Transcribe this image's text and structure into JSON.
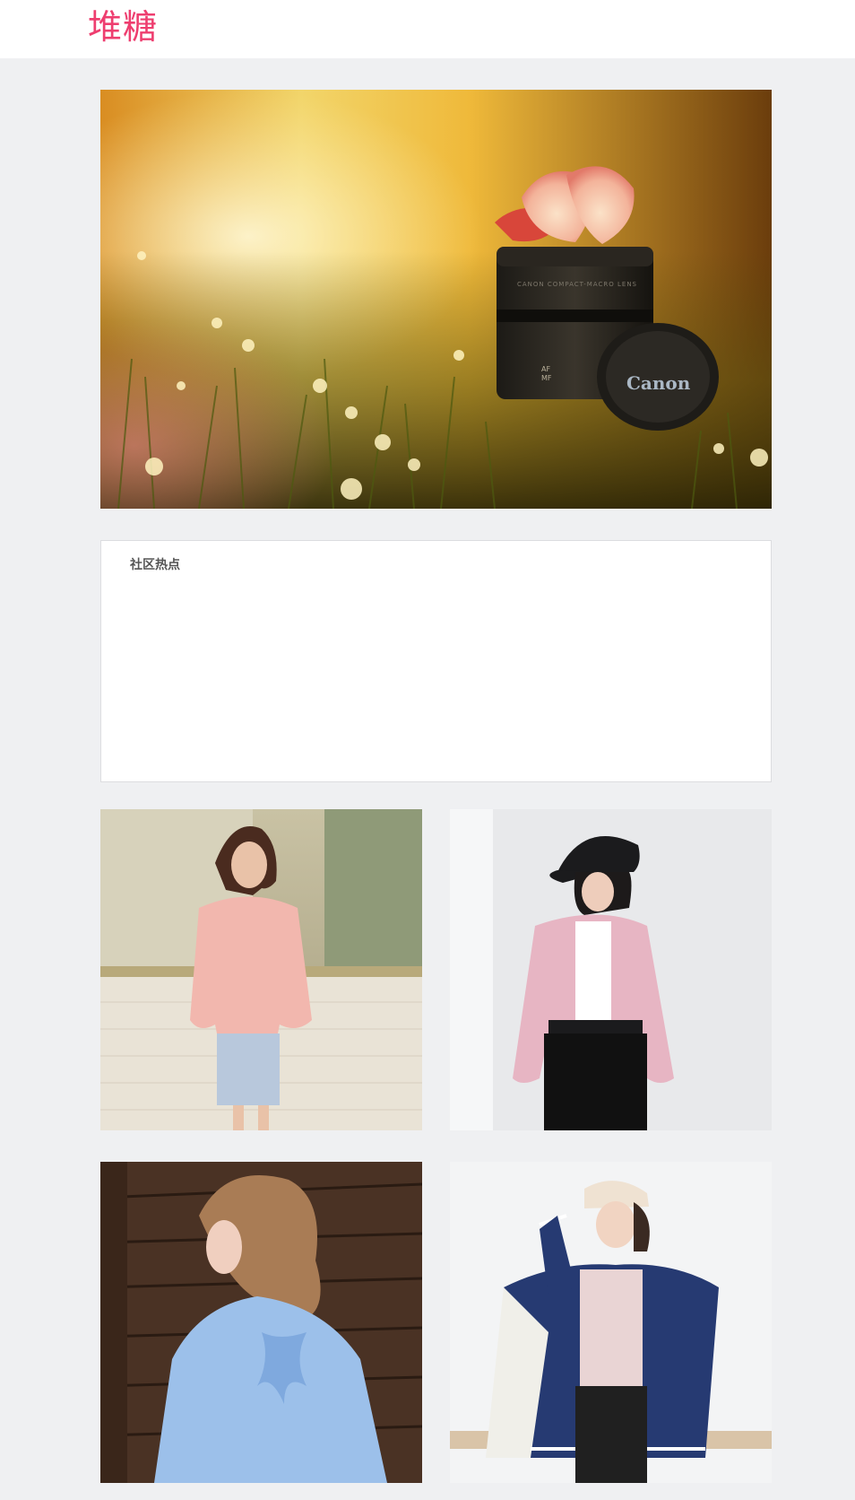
{
  "header": {
    "logo_text": "堆糖"
  },
  "banner": {
    "lens_brand": "Canon",
    "lens_ring_text": "CANON COMPACT-MACRO LENS",
    "lens_switch_labels": [
      "AF",
      "MF"
    ]
  },
  "hot_section": {
    "title": "社区热点"
  },
  "colors": {
    "brand": "#ee3e6f",
    "page_bg": "#eff0f2",
    "panel_bg": "#ffffff",
    "panel_border": "#dcdde0",
    "section_title": "#555555"
  },
  "photo_grid": {
    "tiles": [
      {
        "subject": "woman in pink sweatshirt and striped skirt"
      },
      {
        "subject": "woman in black cap and pink bomber jacket"
      },
      {
        "subject": "woman in blue blouse with back bow"
      },
      {
        "subject": "woman in beige cap and navy varsity jacket"
      }
    ]
  }
}
